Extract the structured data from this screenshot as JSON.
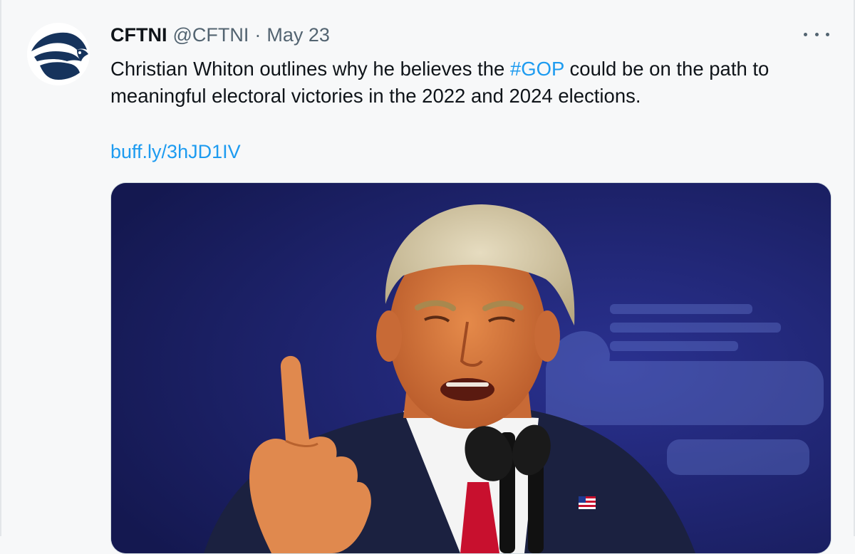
{
  "tweet": {
    "author_name": "CFTNI",
    "author_handle": "@CFTNI",
    "separator": "·",
    "date": "May 23",
    "text_before": "Christian Whiton outlines why he believes the ",
    "hashtag": "#GOP",
    "text_after": " could be on the path to meaningful electoral victories in the 2022 and 2024 elections.",
    "link": "buff.ly/3hJD1IV",
    "avatar_icon": "eagle-logo-icon",
    "more_icon": "more-dots-icon"
  },
  "colors": {
    "link": "#1d9bf0",
    "muted": "#536471",
    "text": "#0f1419",
    "brand": "#16335c",
    "media_bg": "#1a1f68"
  }
}
